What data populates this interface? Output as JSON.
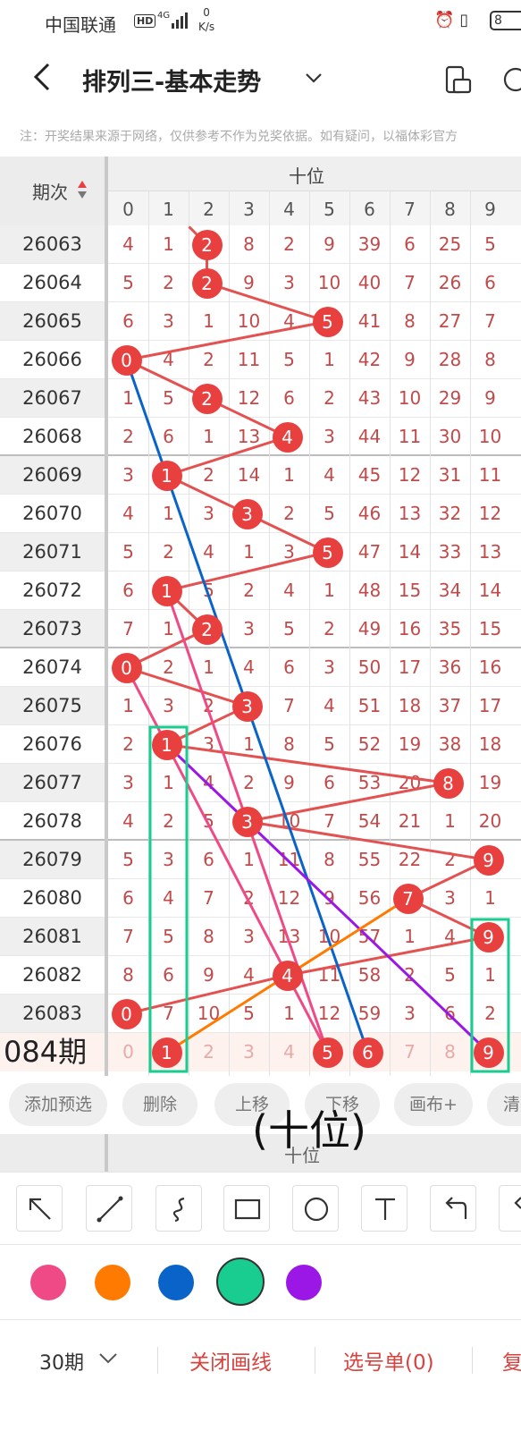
{
  "status_bar": {
    "carrier": "中国联通",
    "hd": "HD",
    "network": "4G",
    "speed_value": "0",
    "speed_unit": "K/s",
    "battery": "8"
  },
  "nav": {
    "title": "排列三-基本走势"
  },
  "notice": "注：开奖结果来源于网络，仅供参考不作为兑奖依据。如有疑问，以福体彩官方",
  "table": {
    "issue_header": "期次",
    "position_header": "十位",
    "digits": [
      "0",
      "1",
      "2",
      "3",
      "4",
      "5",
      "6",
      "7",
      "8",
      "9"
    ],
    "rows": [
      {
        "issue": "26063",
        "cells": [
          "4",
          "1",
          "2",
          "8",
          "2",
          "9",
          "39",
          "6",
          "25",
          "5"
        ],
        "hit": 2
      },
      {
        "issue": "26064",
        "cells": [
          "5",
          "2",
          "2",
          "9",
          "3",
          "10",
          "40",
          "7",
          "26",
          "6"
        ],
        "hit": 2
      },
      {
        "issue": "26065",
        "cells": [
          "6",
          "3",
          "1",
          "10",
          "4",
          "5",
          "41",
          "8",
          "27",
          "7"
        ],
        "hit": 5
      },
      {
        "issue": "26066",
        "cells": [
          "0",
          "4",
          "2",
          "11",
          "5",
          "1",
          "42",
          "9",
          "28",
          "8"
        ],
        "hit": 0
      },
      {
        "issue": "26067",
        "cells": [
          "1",
          "5",
          "2",
          "12",
          "6",
          "2",
          "43",
          "10",
          "29",
          "9"
        ],
        "hit": 2
      },
      {
        "issue": "26068",
        "cells": [
          "2",
          "6",
          "1",
          "13",
          "4",
          "3",
          "44",
          "11",
          "30",
          "10"
        ],
        "hit": 4
      },
      {
        "issue": "26069",
        "cells": [
          "3",
          "1",
          "2",
          "14",
          "1",
          "4",
          "45",
          "12",
          "31",
          "11"
        ],
        "hit": 1
      },
      {
        "issue": "26070",
        "cells": [
          "4",
          "1",
          "3",
          "3",
          "2",
          "5",
          "46",
          "13",
          "32",
          "12"
        ],
        "hit": 3
      },
      {
        "issue": "26071",
        "cells": [
          "5",
          "2",
          "4",
          "1",
          "3",
          "5",
          "47",
          "14",
          "33",
          "13"
        ],
        "hit": 5
      },
      {
        "issue": "26072",
        "cells": [
          "6",
          "1",
          "5",
          "2",
          "4",
          "1",
          "48",
          "15",
          "34",
          "14"
        ],
        "hit": 1
      },
      {
        "issue": "26073",
        "cells": [
          "7",
          "1",
          "2",
          "3",
          "5",
          "2",
          "49",
          "16",
          "35",
          "15"
        ],
        "hit": 2
      },
      {
        "issue": "26074",
        "cells": [
          "0",
          "2",
          "1",
          "4",
          "6",
          "3",
          "50",
          "17",
          "36",
          "16"
        ],
        "hit": 0
      },
      {
        "issue": "26075",
        "cells": [
          "1",
          "3",
          "2",
          "3",
          "7",
          "4",
          "51",
          "18",
          "37",
          "17"
        ],
        "hit": 3
      },
      {
        "issue": "26076",
        "cells": [
          "2",
          "1",
          "3",
          "1",
          "8",
          "5",
          "52",
          "19",
          "38",
          "18"
        ],
        "hit": 1
      },
      {
        "issue": "26077",
        "cells": [
          "3",
          "1",
          "4",
          "2",
          "9",
          "6",
          "53",
          "20",
          "8",
          "19"
        ],
        "hit": 8
      },
      {
        "issue": "26078",
        "cells": [
          "4",
          "2",
          "5",
          "3",
          "10",
          "7",
          "54",
          "21",
          "1",
          "20"
        ],
        "hit": 3
      },
      {
        "issue": "26079",
        "cells": [
          "5",
          "3",
          "6",
          "1",
          "11",
          "8",
          "55",
          "22",
          "2",
          "9"
        ],
        "hit": 9
      },
      {
        "issue": "26080",
        "cells": [
          "6",
          "4",
          "7",
          "2",
          "12",
          "9",
          "56",
          "7",
          "3",
          "1"
        ],
        "hit": 7
      },
      {
        "issue": "26081",
        "cells": [
          "7",
          "5",
          "8",
          "3",
          "13",
          "10",
          "57",
          "1",
          "4",
          "9"
        ],
        "hit": 9
      },
      {
        "issue": "26082",
        "cells": [
          "8",
          "6",
          "9",
          "4",
          "4",
          "11",
          "58",
          "2",
          "5",
          "1"
        ],
        "hit": 4
      },
      {
        "issue": "26083",
        "cells": [
          "0",
          "7",
          "10",
          "5",
          "1",
          "12",
          "59",
          "3",
          "6",
          "2"
        ],
        "hit": 0
      }
    ],
    "current_issue": "084期",
    "current_cells": [
      "0",
      "1",
      "2",
      "3",
      "4",
      "5",
      "6",
      "7",
      "8",
      "9"
    ],
    "current_selected": [
      1,
      5,
      6,
      9
    ]
  },
  "chips": [
    "添加预选",
    "删除",
    "上移",
    "下移",
    "画布+",
    "清"
  ],
  "overlay_text": "(十位)",
  "footer_header": "十位",
  "tools": [
    "arrow-tool",
    "line-tool",
    "curve-tool",
    "rectangle-tool",
    "circle-tool",
    "text-tool",
    "undo-tool",
    "redo-tool"
  ],
  "colors": {
    "pink": "#ef4a86",
    "orange": "#ff7a00",
    "blue": "#0a63c9",
    "green": "#19cc8f",
    "purple": "#9a17e6",
    "ball": "#e8403f",
    "line_red": "#e35151"
  },
  "bottom": {
    "period": "30期",
    "close_lines": "关闭画线",
    "selection": "选号单(0)",
    "last": "复"
  }
}
